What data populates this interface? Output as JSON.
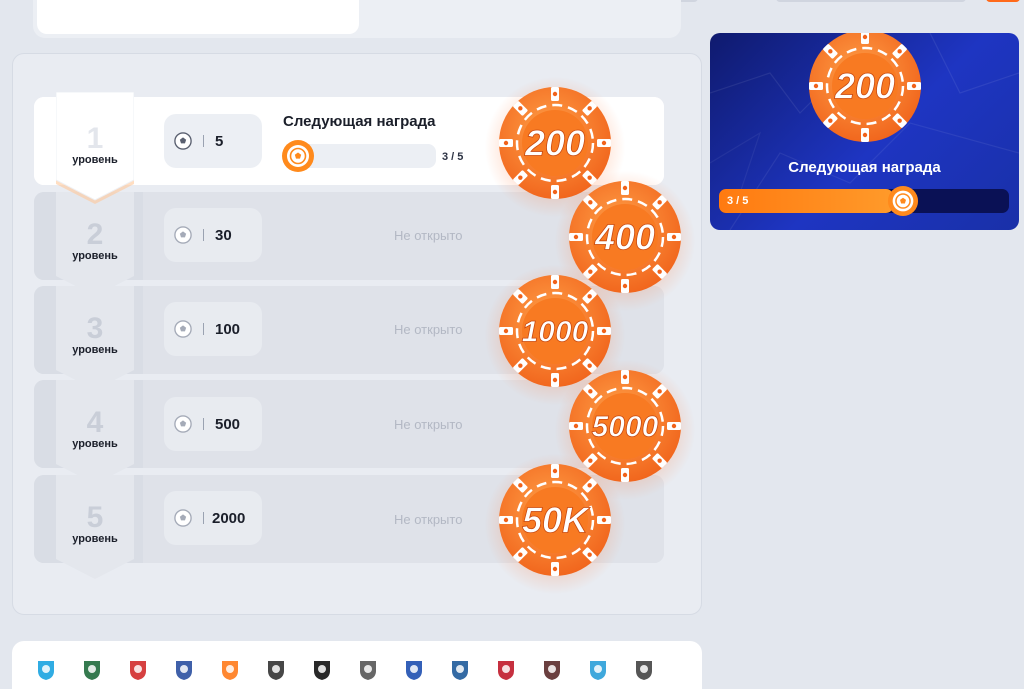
{
  "progress": {
    "title": "Следующая награда",
    "current": 3,
    "total": 5,
    "text": "3 / 5",
    "fraction": 0.6
  },
  "levels": [
    {
      "number": "1",
      "label": "уровень",
      "value": "5",
      "status": "",
      "reward": "200",
      "active": true
    },
    {
      "number": "2",
      "label": "уровень",
      "value": "30",
      "status": "Не открыто",
      "reward": "400",
      "active": false
    },
    {
      "number": "3",
      "label": "уровень",
      "value": "100",
      "status": "Не открыто",
      "reward": "1000",
      "active": false
    },
    {
      "number": "4",
      "label": "уровень",
      "value": "500",
      "status": "Не открыто",
      "reward": "5000",
      "active": false
    },
    {
      "number": "5",
      "label": "уровень",
      "value": "2000",
      "status": "Не открыто",
      "reward": "50K",
      "active": false
    }
  ],
  "reward_card": {
    "chip": "200",
    "title": "Следующая награда",
    "progress_text": "3 / 5"
  },
  "team_logos": [
    "zenit-logo",
    "krasnodar-logo",
    "spartak-logo",
    "cska-logo",
    "ural-logo",
    "akhmat-logo",
    "torpedo-logo",
    "khimki-logo",
    "dynamo-logo",
    "fakel-logo",
    "avangard-logo",
    "rubin-logo",
    "sochi-logo",
    "orenburg-logo"
  ],
  "colors": {
    "accent": "#ff6a1a",
    "card_blue": "#1e35c2",
    "locked_text": "#b3b8c4"
  }
}
